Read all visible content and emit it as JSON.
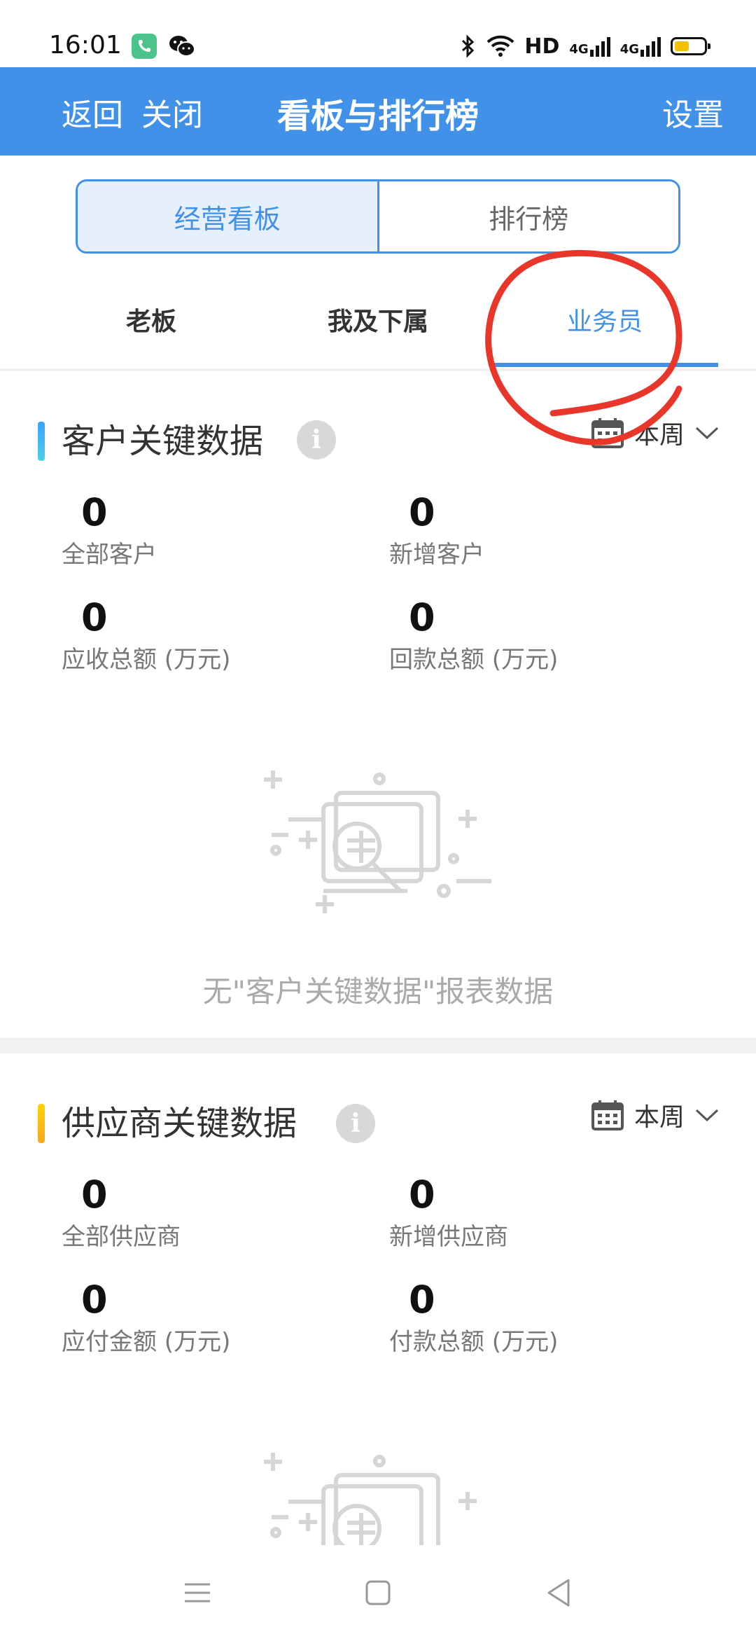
{
  "status_bar": {
    "time": "16:01",
    "hd": "HD",
    "signal_1": "4G",
    "signal_2": "4G",
    "icons": [
      "phone-icon",
      "wechat-icon",
      "bluetooth-icon",
      "wifi-icon",
      "signal-icon",
      "battery-icon"
    ]
  },
  "header": {
    "back_label": "返回",
    "close_label": "关闭",
    "title": "看板与排行榜",
    "settings_label": "设置"
  },
  "segment": {
    "active_label": "经营看板",
    "inactive_label": "排行榜"
  },
  "subtabs": {
    "items": [
      "老板",
      "我及下属",
      "业务员"
    ],
    "selected": "业务员"
  },
  "customer_section": {
    "title": "客户关键数据",
    "period": "本周",
    "stats": [
      {
        "value": "0",
        "label": "全部客户"
      },
      {
        "value": "0",
        "label": "新增客户"
      },
      {
        "value": "0",
        "label": "应收总额 (万元)"
      },
      {
        "value": "0",
        "label": "回款总额 (万元)"
      }
    ],
    "empty_text": "无\"客户关键数据\"报表数据"
  },
  "supplier_section": {
    "title": "供应商关键数据",
    "period": "本周",
    "stats": [
      {
        "value": "0",
        "label": "全部供应商"
      },
      {
        "value": "0",
        "label": "新增供应商"
      },
      {
        "value": "0",
        "label": "应付金额 (万元)"
      },
      {
        "value": "0",
        "label": "付款总额 (万元)"
      }
    ]
  },
  "colors": {
    "brand_blue": "#4191e9",
    "annotation_red": "#e8372a",
    "customer_accent": "#4191e9",
    "supplier_accent": "#f5c518"
  }
}
